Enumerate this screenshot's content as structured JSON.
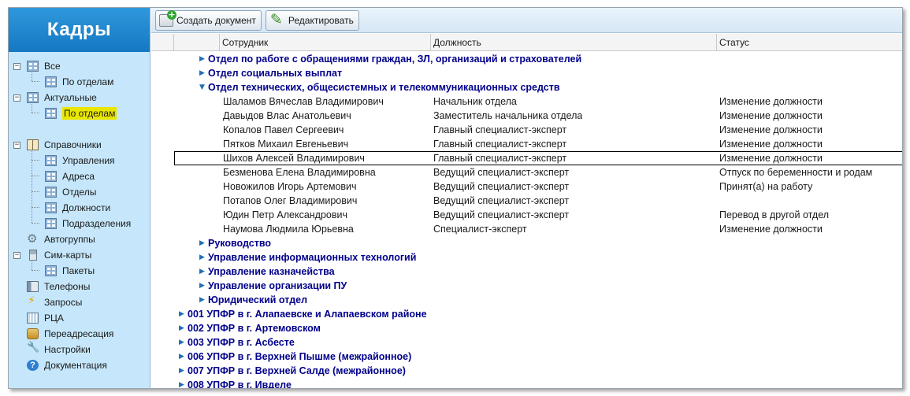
{
  "app": {
    "title": "Кадры"
  },
  "sidebar": {
    "items": [
      {
        "label": "Все"
      },
      {
        "label": "По отделам"
      },
      {
        "label": "Актуальные"
      },
      {
        "label": "По отделам"
      },
      {
        "label": "Справочники"
      },
      {
        "label": "Управления"
      },
      {
        "label": "Адреса"
      },
      {
        "label": "Отделы"
      },
      {
        "label": "Должности"
      },
      {
        "label": "Подразделения"
      },
      {
        "label": "Автогруппы"
      },
      {
        "label": "Сим-карты"
      },
      {
        "label": "Пакеты"
      },
      {
        "label": "Телефоны"
      },
      {
        "label": "Запросы"
      },
      {
        "label": "РЦА"
      },
      {
        "label": "Переадресация"
      },
      {
        "label": "Настройки"
      },
      {
        "label": "Документация"
      }
    ],
    "icons": [
      "grid-icon",
      "grid-icon",
      "grid-icon",
      "grid-icon",
      "book-icon",
      "grid-icon",
      "grid-icon",
      "grid-icon",
      "grid-icon",
      "grid-icon",
      "gear-icon",
      "sim-card-icon",
      "grid-icon",
      "phone-icon",
      "lightning-icon",
      "rca-icon",
      "redirect-icon",
      "wrench-icon",
      "help-icon"
    ],
    "accent": "#e9e600"
  },
  "toolbar": {
    "create_label": "Создать документ",
    "edit_label": "Редактировать"
  },
  "grid": {
    "columns": [
      "Сотрудник",
      "Должность",
      "Статус"
    ],
    "groups_top": [
      "Отдел по работе с обращениями граждан, ЗЛ, организаций и страхователей",
      "Отдел социальных выплат",
      "Отдел технических, общесистемных и телекоммуникационных средств"
    ],
    "employees": [
      {
        "name": "Шаламов Вячеслав Владимирович",
        "position": "Начальник отдела",
        "status": "Изменение должности"
      },
      {
        "name": "Давыдов Влас Анатольевич",
        "position": "Заместитель начальника отдела",
        "status": "Изменение должности"
      },
      {
        "name": "Копалов Павел Сергеевич",
        "position": "Главный специалист-эксперт",
        "status": "Изменение должности"
      },
      {
        "name": "Пятков Михаил Евгеньевич",
        "position": "Главный специалист-эксперт",
        "status": "Изменение должности"
      },
      {
        "name": "Шихов Алексей Владимирович",
        "position": "Главный специалист-эксперт",
        "status": "Изменение должности"
      },
      {
        "name": "Безменова Елена Владимировна",
        "position": "Ведущий специалист-эксперт",
        "status": "Отпуск по беременности и родам"
      },
      {
        "name": "Новожилов Игорь Артемович",
        "position": "Ведущий специалист-эксперт",
        "status": "Принят(а) на работу"
      },
      {
        "name": "Потапов Олег Владимирович",
        "position": "Ведущий специалист-эксперт",
        "status": ""
      },
      {
        "name": "Юдин Петр Александрович",
        "position": "Ведущий специалист-эксперт",
        "status": "Перевод в другой отдел"
      },
      {
        "name": "Наумова Людмила Юрьевна",
        "position": "Специалист-эксперт",
        "status": "Изменение должности"
      }
    ],
    "groups_sub": [
      "Руководство",
      "Управление информационных технологий",
      "Управление казначейства",
      "Управление организации ПУ",
      "Юридический отдел"
    ],
    "groups_root": [
      "001 УПФР в г. Алапаевске и Алапаевском районе",
      "002 УПФР в г. Артемовском",
      "003 УПФР в г. Асбесте",
      "006 УПФР в г. Верхней Пышме (межрайонное)",
      "007 УПФР в г. Верхней Салде (межрайонное)",
      "008 УПФР в г. Ивделе"
    ]
  }
}
